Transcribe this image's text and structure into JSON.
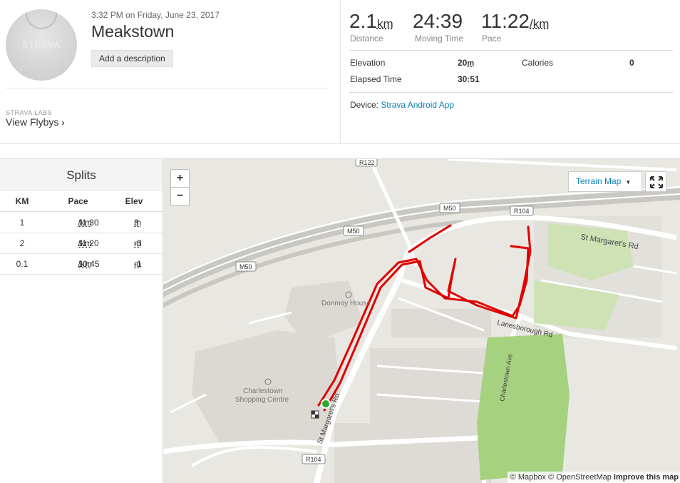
{
  "activity": {
    "datetime": "3:32 PM on Friday, June 23, 2017",
    "title": "Meakstown",
    "add_description_label": "Add a description",
    "avatar_brand": "STRAVA",
    "labs_tag": "STRAVA LABS",
    "flybys_label": "View Flybys"
  },
  "stats": {
    "distance": {
      "value": "2.1",
      "unit": "km",
      "label": "Distance"
    },
    "moving_time": {
      "value": "24:39",
      "label": "Moving Time"
    },
    "pace": {
      "value": "11:22",
      "unit": "/km",
      "label": "Pace"
    },
    "elevation_label": "Elevation",
    "elevation_value": "20",
    "elevation_unit": "m",
    "calories_label": "Calories",
    "calories_value": "0",
    "elapsed_label": "Elapsed Time",
    "elapsed_value": "30:51",
    "device_label": "Device:",
    "device_value": "Strava Android App"
  },
  "splits": {
    "title": "Splits",
    "headers": [
      "KM",
      "Pace",
      "Elev"
    ],
    "rows": [
      {
        "km": "1",
        "pace": "11:30",
        "pace_unit": "/km",
        "elev": "3",
        "elev_unit": "m"
      },
      {
        "km": "2",
        "pace": "11:20",
        "pace_unit": "/km",
        "elev": "-3",
        "elev_unit": "m"
      },
      {
        "km": "0.1",
        "pace": "10:45",
        "pace_unit": "/km",
        "elev": "-1",
        "elev_unit": "m"
      }
    ]
  },
  "map": {
    "zoom_in": "+",
    "zoom_out": "−",
    "map_type": "Terrain Map",
    "attribution_mapbox": "© Mapbox",
    "attribution_osm": "© OpenStreetMap",
    "attribution_improve": "Improve this map",
    "labels": {
      "road_r122": "R122",
      "road_m50_a": "M50",
      "road_m50_b": "M50",
      "road_m50_c": "M50",
      "road_r104_a": "R104",
      "road_r104_b": "R104",
      "st_margarets_rd": "St Margaret's Rd",
      "st_margarets_rd_2": "St Margaret's Rd",
      "lanesborough_rd": "Lanesborough Rd",
      "charlestown_ave": "Charlestown Ave",
      "donmoy_house": "Donmoy House",
      "charlestown_sc_1": "Charlestown",
      "charlestown_sc_2": "Shopping Centre"
    },
    "route_color": "#e00000",
    "park_color": "#a6d17f"
  }
}
